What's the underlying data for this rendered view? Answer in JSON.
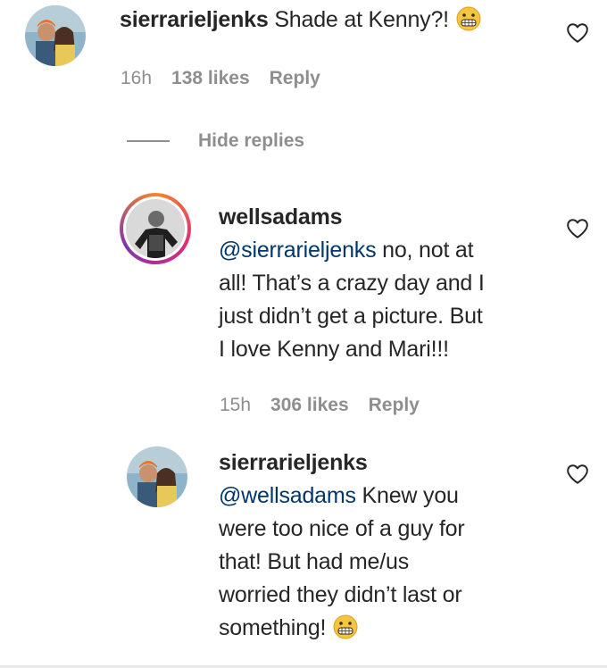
{
  "comment1": {
    "username": "sierrarieljenks",
    "text": "Shade at Kenny?!",
    "time": "16h",
    "likes": "138 likes",
    "reply": "Reply"
  },
  "hide_replies": "Hide replies",
  "reply1": {
    "username": "wellsadams",
    "mention": "@sierrarieljenks",
    "text_line1_rest": " no, not at",
    "text_line2": "all! That’s a crazy day and I",
    "text_line3": "just didn’t get a picture. But",
    "text_line4": "I love Kenny and Mari!!!",
    "time": "15h",
    "likes": "306 likes",
    "reply": "Reply"
  },
  "reply2": {
    "username": "sierrarieljenks",
    "mention": "@wellsadams",
    "text_line1_rest": " Knew you",
    "text_line2": "were too nice of a guy for",
    "text_line3": "that! But had me/us",
    "text_line4": "worried they didn’t last or",
    "text_line5": "something!"
  },
  "icons": {
    "like": "heart-outline-icon",
    "emoji": "grimacing-face-emoji"
  },
  "colors": {
    "text": "#262626",
    "secondary": "#8e8e8e",
    "mention": "#00376b",
    "story_ring_start": "#f58529",
    "story_ring_end": "#dd2a7b"
  }
}
